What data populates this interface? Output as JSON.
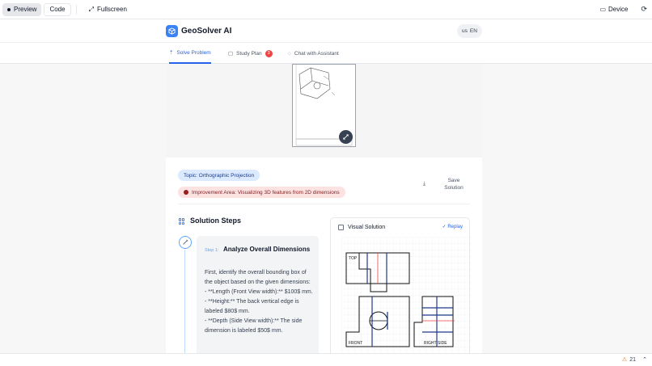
{
  "topbar": {
    "preview_label": "Preview",
    "code_label": "Code",
    "fullscreen_label": "Fullscreen",
    "device_label": "Device"
  },
  "header": {
    "brand": "GeoSolver AI",
    "lang_flag": "us",
    "lang_code": "EN"
  },
  "tabs": [
    {
      "label": "Solve Problem",
      "active": true
    },
    {
      "label": "Study Plan",
      "badge": "3"
    },
    {
      "label": "Chat with Assistant"
    }
  ],
  "tags": {
    "topic": "Topic: Orthographic Projection",
    "improvement": "Improvement Area: Visualizing 3D features from 2D dimensions"
  },
  "save_label": "Save Solution",
  "steps": {
    "title": "Solution Steps",
    "items": [
      {
        "num": "Step 1:",
        "title": "Analyze Overall Dimensions",
        "body_lines": [
          "First, identify the overall bounding box of the object based on the given dimensions:",
          "- **Length (Front View width):** $100$ mm.",
          "- **Height:** The back vertical edge is labeled $80$ mm.",
          "- **Depth (Side View width):** The side dimension is labeled $50$ mm."
        ]
      }
    ]
  },
  "visual_solution": {
    "title": "Visual Solution",
    "replay_label": "Replay",
    "view_labels": {
      "top": "TOP",
      "front": "FRONT",
      "right": "RIGHT SIDE"
    }
  },
  "status": {
    "warning_count": "21"
  },
  "colors": {
    "accent": "#2563eb",
    "badge": "#ef4444",
    "topic_bg": "#dbeafe",
    "improve_bg": "#fde2e2"
  }
}
